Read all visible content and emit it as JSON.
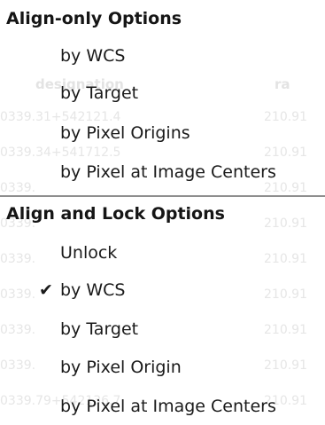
{
  "menu": {
    "align_only_header": "Align-only Options",
    "align_only_items": [
      {
        "label": "by WCS",
        "checked": false
      },
      {
        "label": "by Target",
        "checked": false
      },
      {
        "label": "by Pixel Origins",
        "checked": false
      },
      {
        "label": "by Pixel at Image Centers",
        "checked": false
      }
    ],
    "align_lock_header": "Align and Lock Options",
    "align_lock_items": [
      {
        "label": "Unlock",
        "checked": false
      },
      {
        "label": "by WCS",
        "checked": true
      },
      {
        "label": "by Target",
        "checked": false
      },
      {
        "label": "by Pixel Origin",
        "checked": false
      },
      {
        "label": "by Pixel at Image Centers",
        "checked": false
      }
    ],
    "check_mark": "✔"
  },
  "background_table": {
    "headers": [
      "designation",
      "ra"
    ],
    "rows": [
      [
        "0339.31+542121.4",
        "210.91"
      ],
      [
        "0339.34+541712.5",
        "210.91"
      ],
      [
        "0339.",
        "210.91"
      ],
      [
        "0339.",
        "210.91"
      ],
      [
        "0339.",
        "210.91"
      ],
      [
        "0339.",
        "210.91"
      ],
      [
        "0339.",
        "210.91"
      ],
      [
        "0339.",
        "210.91"
      ],
      [
        "0339.79+542136.7",
        "210.91"
      ]
    ]
  }
}
